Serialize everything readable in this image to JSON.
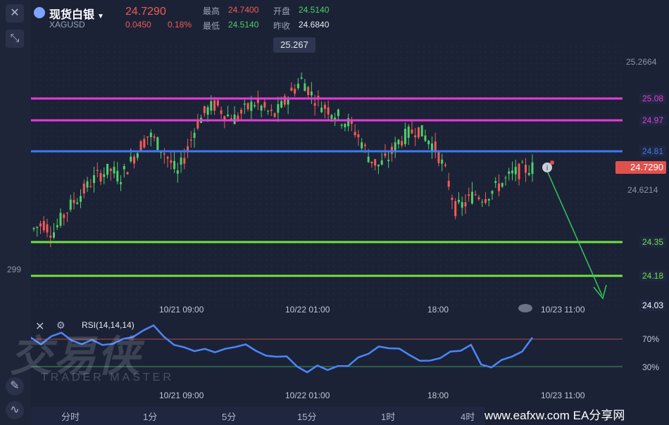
{
  "header": {
    "title": "现货白银",
    "symbol": "XAGUSD",
    "price": "24.7290",
    "change": "0.0450",
    "change_pct": "0.18%",
    "high_label": "最高",
    "high_value": "24.7400",
    "open_label": "开盘",
    "open_value": "24.5140",
    "low_label": "最低",
    "low_value": "24.5140",
    "prev_label": "昨收",
    "prev_value": "24.6840"
  },
  "tooltip_high": "25.267",
  "price_axis": {
    "labels": [
      "25.2664",
      "24.6214"
    ],
    "partial_left": "299"
  },
  "hlines": [
    {
      "value": "25.08",
      "color": "#e83ad8"
    },
    {
      "value": "24.97",
      "color": "#e83ad8"
    },
    {
      "value": "24.81",
      "color": "#3d7bf2"
    },
    {
      "value": "24.35",
      "color": "#6fe33f"
    },
    {
      "value": "24.18",
      "color": "#6fe33f"
    },
    {
      "value": "24.03",
      "color": "#ffffff"
    }
  ],
  "current_price_tag": "24.7290",
  "time_axis": [
    "10/21 09:00",
    "10/22 01:00",
    "18:00",
    "10/23 11:00"
  ],
  "rsi": {
    "label": "RSI(14,14,14)",
    "level_high": "70%",
    "level_low": "30%"
  },
  "timeframes": [
    "分时",
    "1分",
    "5分",
    "15分",
    "1时",
    "4时"
  ],
  "watermark": {
    "cn": "交易侠",
    "en": "TRADER MASTER"
  },
  "site_credit": "www.eafxw.com  EA分享网",
  "colors": {
    "up": "#4fcf6a",
    "down": "#f25b57",
    "bg": "#1b2236",
    "rsi_line": "#4c86f7"
  },
  "chart_data": {
    "type": "candlestick",
    "symbol": "XAGUSD",
    "ylabels_visible": [
      25.2664,
      24.6214
    ],
    "horizontal_levels": [
      25.08,
      24.97,
      24.81,
      24.35,
      24.18,
      24.03
    ],
    "last_price": 24.729,
    "session_high": 25.267,
    "rsi_levels": [
      70,
      30
    ]
  }
}
